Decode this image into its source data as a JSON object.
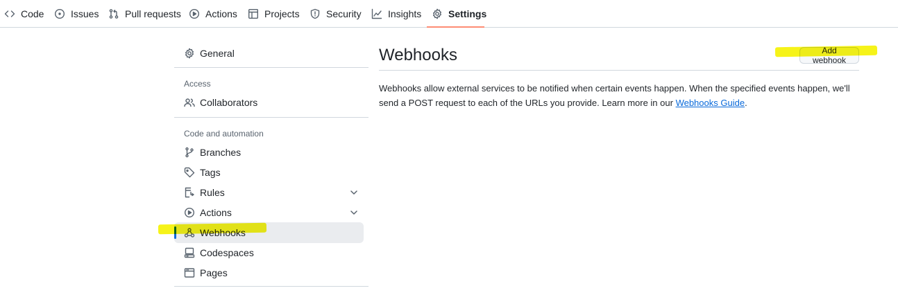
{
  "topnav": {
    "tabs": [
      {
        "label": "Code",
        "icon": "code-icon"
      },
      {
        "label": "Issues",
        "icon": "issue-opened-icon"
      },
      {
        "label": "Pull requests",
        "icon": "git-pull-request-icon"
      },
      {
        "label": "Actions",
        "icon": "play-icon"
      },
      {
        "label": "Projects",
        "icon": "table-icon"
      },
      {
        "label": "Security",
        "icon": "shield-icon"
      },
      {
        "label": "Insights",
        "icon": "graph-icon"
      },
      {
        "label": "Settings",
        "icon": "gear-icon"
      }
    ],
    "selected": "Settings",
    "underline_color": "#fd8c73"
  },
  "sidebar": {
    "general": "General",
    "access_heading": "Access",
    "collaborators": "Collaborators",
    "code_heading": "Code and automation",
    "items": [
      {
        "label": "Branches",
        "icon": "git-branch-icon"
      },
      {
        "label": "Tags",
        "icon": "tag-icon"
      },
      {
        "label": "Rules",
        "icon": "rules-icon"
      },
      {
        "label": "Actions",
        "icon": "play-icon"
      },
      {
        "label": "Webhooks",
        "icon": "webhook-icon"
      },
      {
        "label": "Codespaces",
        "icon": "codespaces-icon"
      },
      {
        "label": "Pages",
        "icon": "browser-icon"
      }
    ],
    "active": "Webhooks",
    "active_color": "#0969da"
  },
  "main": {
    "title": "Webhooks",
    "add_button": "Add webhook",
    "description_pre": "Webhooks allow external services to be notified when certain events happen. When the specified events happen, we'll send a POST request to each of the URLs you provide. Learn more in our ",
    "description_link": "Webhooks Guide",
    "description_post": "."
  },
  "highlight_color": "#f5f200"
}
